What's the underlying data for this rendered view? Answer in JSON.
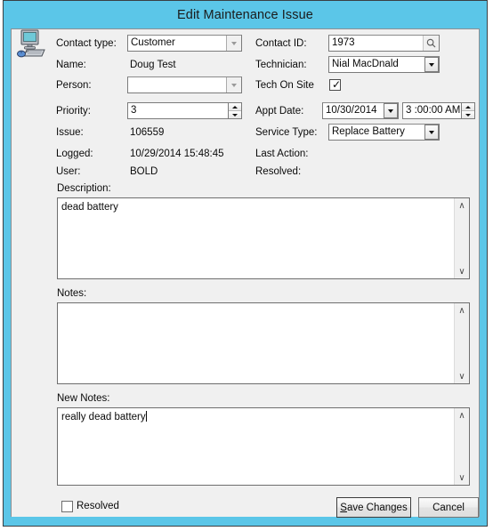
{
  "window": {
    "title": "Edit Maintenance Issue",
    "accent_color": "#5bc6e8",
    "client_bg": "#f0f0f0",
    "app_icon": "computer-icon"
  },
  "form": {
    "left": {
      "contact_type": {
        "label": "Contact type:",
        "value": "Customer",
        "control": "combobox"
      },
      "name": {
        "label": "Name:",
        "value": "Doug Test",
        "control": "static-text"
      },
      "person": {
        "label": "Person:",
        "value": "",
        "control": "combobox"
      },
      "priority": {
        "label": "Priority:",
        "value": "3",
        "control": "spinner"
      },
      "issue": {
        "label": "Issue:",
        "value": "106559",
        "control": "static-text"
      },
      "logged": {
        "label": "Logged:",
        "value": "10/29/2014 15:48:45",
        "control": "static-text"
      },
      "user": {
        "label": "User:",
        "value": "BOLD",
        "control": "static-text"
      }
    },
    "right": {
      "contact_id": {
        "label": "Contact ID:",
        "value": "1973",
        "control": "textbox",
        "icon": "search-icon"
      },
      "technician": {
        "label": "Technician:",
        "value": "Nial MacDnald",
        "control": "combobox"
      },
      "tech_on_site": {
        "label": "Tech On Site",
        "checked": true,
        "control": "checkbox"
      },
      "appt_date": {
        "label": "Appt Date:",
        "date_value": "10/30/2014",
        "time_value": "3 :00:00 AM",
        "control": "datetime"
      },
      "service_type": {
        "label": "Service Type:",
        "value": "Replace Battery",
        "control": "combobox"
      },
      "last_action": {
        "label": "Last Action:",
        "value": "",
        "control": "static-text"
      },
      "resolved_ro": {
        "label": "Resolved:",
        "value": "",
        "control": "static-text"
      }
    }
  },
  "description": {
    "label": "Description:",
    "value": "dead battery"
  },
  "notes": {
    "label": "Notes:",
    "value": ""
  },
  "new_notes": {
    "label": "New Notes:",
    "value": "really dead battery"
  },
  "footer": {
    "resolved_checkbox": {
      "label": "Resolved",
      "checked": false
    },
    "save_button": {
      "accel": "S",
      "rest": "ave Changes"
    },
    "cancel_button": {
      "label": "Cancel"
    }
  },
  "scrollbar": {
    "up_glyph": "∧",
    "down_glyph": "∨"
  }
}
